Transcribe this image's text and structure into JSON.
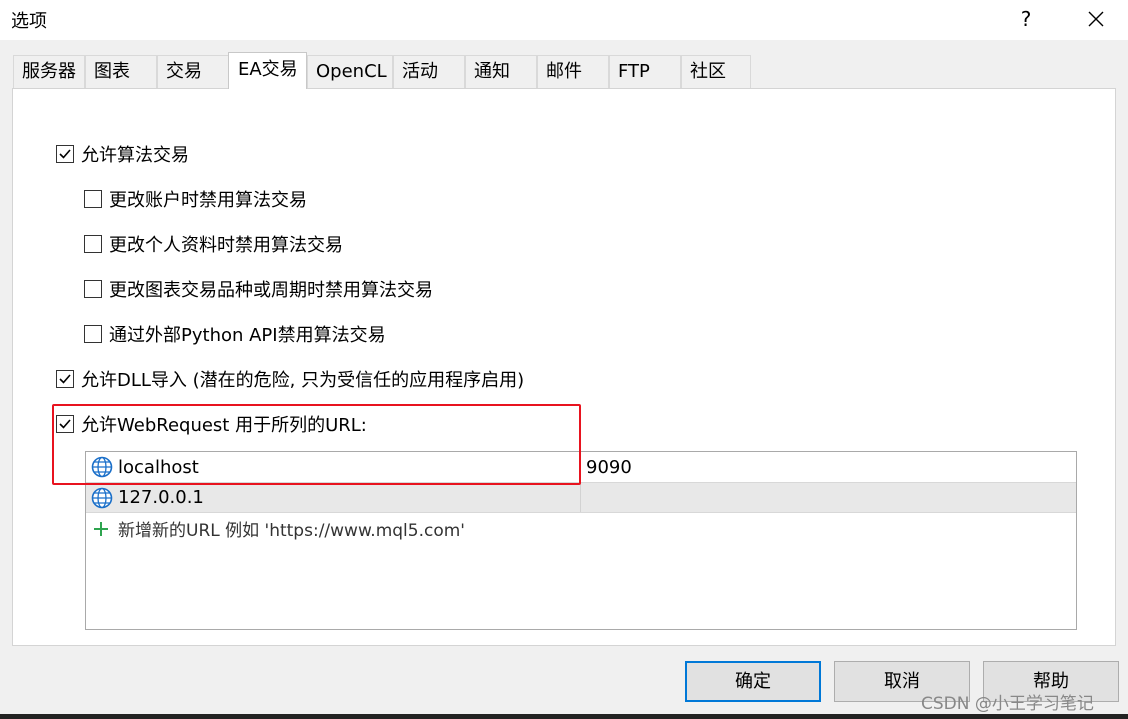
{
  "window": {
    "title": "选项",
    "help_label": "?",
    "close_icon": "close-icon"
  },
  "tabs": [
    {
      "label": "服务器"
    },
    {
      "label": "图表"
    },
    {
      "label": "交易"
    },
    {
      "label": "EA交易",
      "active": true
    },
    {
      "label": "OpenCL"
    },
    {
      "label": "活动"
    },
    {
      "label": "通知"
    },
    {
      "label": "邮件"
    },
    {
      "label": "FTP"
    },
    {
      "label": "社区"
    }
  ],
  "options": {
    "allow_algo": {
      "label": "允许算法交易",
      "checked": true
    },
    "disable_on_account_change": {
      "label": "更改账户时禁用算法交易",
      "checked": false
    },
    "disable_on_profile_change": {
      "label": "更改个人资料时禁用算法交易",
      "checked": false
    },
    "disable_on_chart_change": {
      "label": "更改图表交易品种或周期时禁用算法交易",
      "checked": false
    },
    "disable_via_python": {
      "label": "通过外部Python API禁用算法交易",
      "checked": false
    },
    "allow_dll": {
      "label": "允许DLL导入 (潜在的危险, 只为受信任的应用程序启用)",
      "checked": true
    },
    "allow_webrequest": {
      "label": "允许WebRequest 用于所列的URL:",
      "checked": true
    }
  },
  "url_list": {
    "rows": [
      {
        "host": "localhost",
        "port": "9090",
        "icon": "globe-icon"
      },
      {
        "host": "127.0.0.1",
        "port": "",
        "icon": "globe-icon"
      }
    ],
    "add_label": "新增新的URL 例如 'https://www.mql5.com'",
    "add_icon": "plus-icon"
  },
  "buttons": {
    "ok": "确定",
    "cancel": "取消",
    "help": "帮助"
  },
  "watermark": "CSDN @小王学习笔记",
  "colors": {
    "highlight_box": "#e8131f",
    "primary_border": "#0078d7",
    "globe": "#1a6fc9",
    "plus": "#2ea44f"
  }
}
